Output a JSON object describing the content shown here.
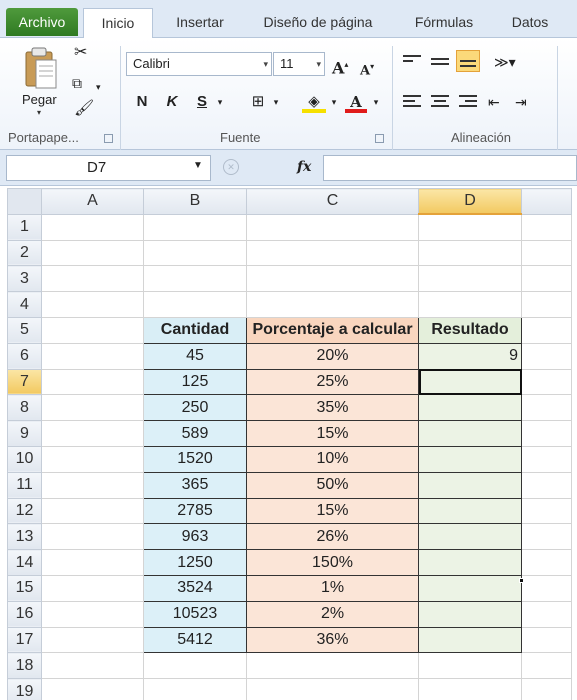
{
  "ribbon": {
    "tabs": [
      "Archivo",
      "Inicio",
      "Insertar",
      "Diseño de página",
      "Fórmulas",
      "Datos"
    ],
    "active_tab": "Inicio",
    "clipboard": {
      "paste_label": "Pegar",
      "group_label": "Portapape..."
    },
    "font": {
      "name": "Calibri",
      "size": "11",
      "bold": "N",
      "italic": "K",
      "underline": "S",
      "group_label": "Fuente"
    },
    "alignment": {
      "group_label": "Alineación"
    }
  },
  "formula_bar": {
    "name_box": "D7",
    "fx_label": "fx",
    "formula": ""
  },
  "sheet": {
    "columns": [
      "A",
      "B",
      "C",
      "D"
    ],
    "selected_column": "D",
    "selected_row": "7",
    "row_numbers": [
      "1",
      "2",
      "3",
      "4",
      "5",
      "6",
      "7",
      "8",
      "9",
      "10",
      "11",
      "12",
      "13",
      "14",
      "15",
      "16",
      "17",
      "18",
      "19"
    ],
    "headers": {
      "cantidad": "Cantidad",
      "porcentaje": "Porcentaje a calcular",
      "resultado": "Resultado"
    },
    "rows": [
      {
        "cantidad": "45",
        "porcentaje": "20%",
        "resultado": "9"
      },
      {
        "cantidad": "125",
        "porcentaje": "25%",
        "resultado": ""
      },
      {
        "cantidad": "250",
        "porcentaje": "35%",
        "resultado": ""
      },
      {
        "cantidad": "589",
        "porcentaje": "15%",
        "resultado": ""
      },
      {
        "cantidad": "1520",
        "porcentaje": "10%",
        "resultado": ""
      },
      {
        "cantidad": "365",
        "porcentaje": "50%",
        "resultado": ""
      },
      {
        "cantidad": "2785",
        "porcentaje": "15%",
        "resultado": ""
      },
      {
        "cantidad": "963",
        "porcentaje": "26%",
        "resultado": ""
      },
      {
        "cantidad": "1250",
        "porcentaje": "150%",
        "resultado": ""
      },
      {
        "cantidad": "3524",
        "porcentaje": "1%",
        "resultado": ""
      },
      {
        "cantidad": "10523",
        "porcentaje": "2%",
        "resultado": ""
      },
      {
        "cantidad": "5412",
        "porcentaje": "36%",
        "resultado": ""
      }
    ]
  },
  "colors": {
    "file_tab": "#3a8a2c",
    "selection": "#f2c961",
    "col_b": "#dcf0f8",
    "col_c": "#fbe5d7",
    "col_d": "#ecf3e5"
  }
}
